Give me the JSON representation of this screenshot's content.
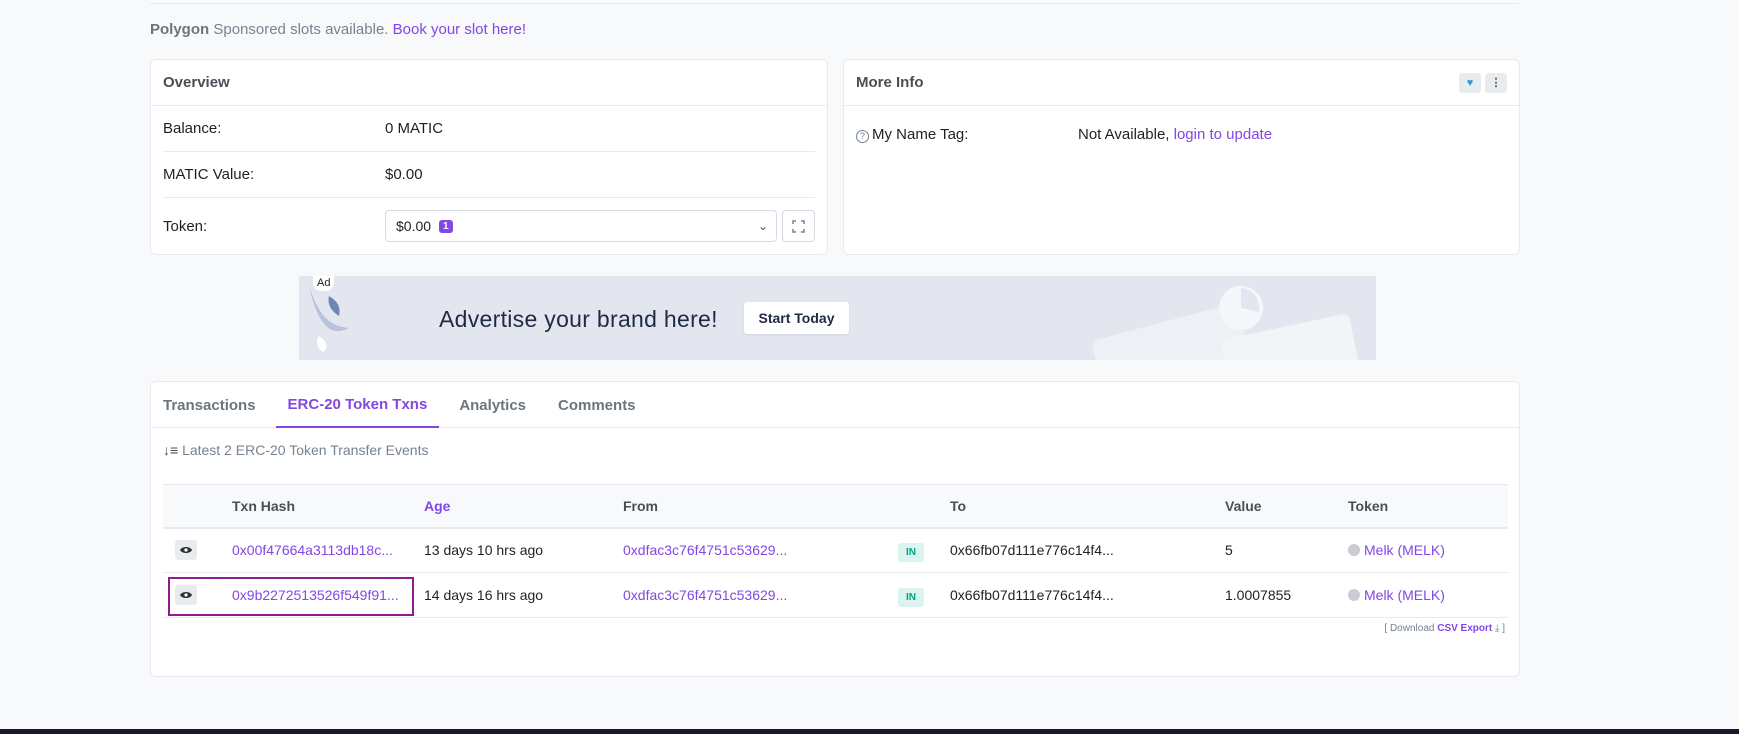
{
  "sponsor": {
    "brand": "Polygon",
    "text": "Sponsored slots available.",
    "link": "Book your slot here!"
  },
  "overview": {
    "title": "Overview",
    "balance_label": "Balance:",
    "balance_value": "0 MATIC",
    "value_label": "MATIC Value:",
    "value_value": "$0.00",
    "token_label": "Token:",
    "token_value": "$0.00",
    "token_count": "1"
  },
  "more_info": {
    "title": "More Info",
    "name_tag_label": "My Name Tag:",
    "name_tag_value": "Not Available,",
    "name_tag_link": "login to update"
  },
  "ad": {
    "label": "Ad",
    "text": "Advertise your brand here!",
    "button": "Start Today"
  },
  "tabs": [
    {
      "label": "Transactions"
    },
    {
      "label": "ERC-20 Token Txns"
    },
    {
      "label": "Analytics"
    },
    {
      "label": "Comments"
    }
  ],
  "table": {
    "summary": "Latest 2 ERC-20 Token Transfer Events",
    "headers": {
      "hash": "Txn Hash",
      "age": "Age",
      "from": "From",
      "to": "To",
      "value": "Value",
      "token": "Token"
    },
    "rows": [
      {
        "hash": "0x00f47664a3113db18c...",
        "age": "13 days 10 hrs ago",
        "from": "0xdfac3c76f4751c53629...",
        "direction": "IN",
        "to": "0x66fb07d111e776c14f4...",
        "value": "5",
        "token": "Melk (MELK)"
      },
      {
        "hash": "0x9b2272513526f549f91...",
        "age": "14 days 16 hrs ago",
        "from": "0xdfac3c76f4751c53629...",
        "direction": "IN",
        "to": "0x66fb07d111e776c14f4...",
        "value": "1.0007855",
        "token": "Melk (MELK)"
      }
    ],
    "csv_prefix": "[ Download",
    "csv_link": "CSV Export",
    "csv_suffix": "]"
  },
  "colors": {
    "accent": "#8247e5",
    "in_badge": "#00a186",
    "highlight": "#8b1d8e"
  }
}
